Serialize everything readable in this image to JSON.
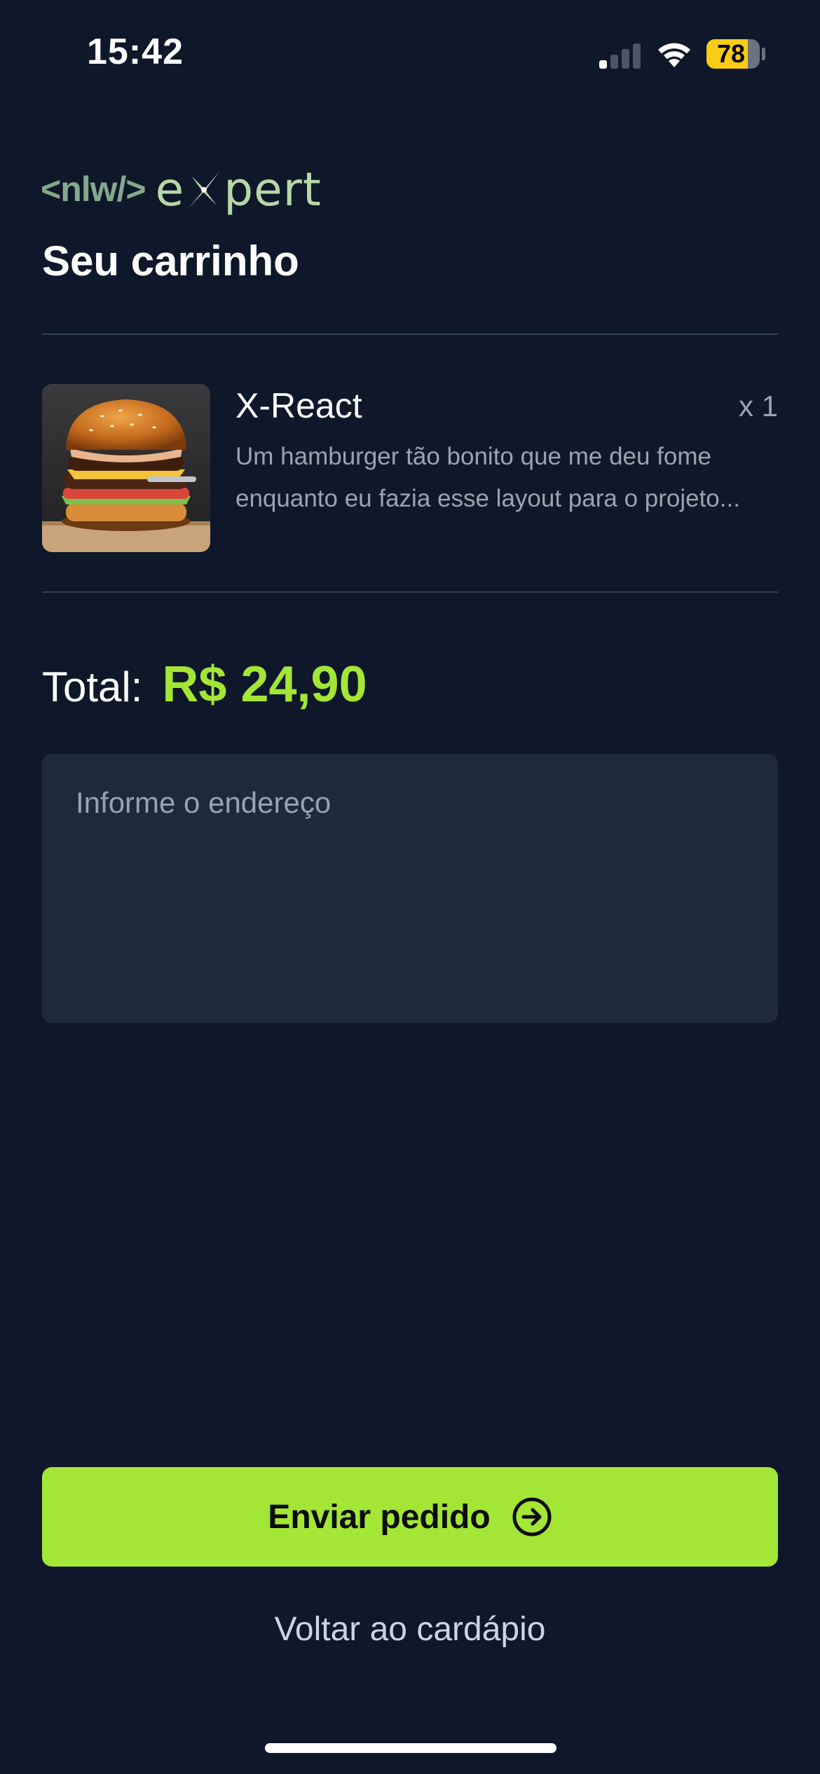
{
  "status_bar": {
    "time": "15:42",
    "battery_level": 78,
    "battery_text": "78",
    "signal_icon": "cellular-signal-icon",
    "wifi_icon": "wifi-icon",
    "battery_icon": "battery-icon",
    "battery_color": "#facc15"
  },
  "brand": {
    "code_text": "<nlw/>",
    "word_start": "e",
    "word_end": "pert",
    "mark_icon": "sparkle-x-icon"
  },
  "page": {
    "title": "Seu carrinho"
  },
  "cart": {
    "items": [
      {
        "name": "X-React",
        "quantity": "x 1",
        "description": "Um hamburger tão bonito que me deu fome enquanto eu fazia esse layout para o projeto...",
        "image_icon": "burger-image"
      }
    ]
  },
  "total": {
    "label": "Total:",
    "value": "R$ 24,90",
    "accent_color": "#a3e635"
  },
  "address": {
    "placeholder": "Informe o endereço",
    "value": ""
  },
  "actions": {
    "send_label": "Enviar pedido",
    "send_icon": "arrow-circle-right-icon",
    "back_label": "Voltar ao cardápio"
  },
  "colors": {
    "background": "#0f172a",
    "surface": "#1e293b",
    "accent": "#a3e635",
    "muted_text": "#9ca3af"
  }
}
